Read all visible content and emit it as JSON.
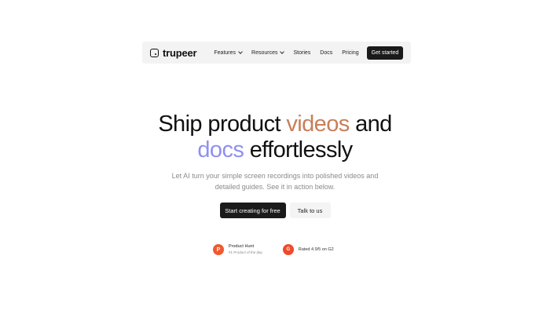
{
  "nav": {
    "brand": "trupeer",
    "links": [
      "Features",
      "Resources",
      "Stories",
      "Docs",
      "Pricing"
    ],
    "cta": "Get started"
  },
  "hero": {
    "line1_a": "Ship product ",
    "line1_b": "videos",
    "line1_c": " and",
    "line2_a": "docs",
    "line2_b": " effortlessly",
    "subtitle_1": "Let AI turn your simple screen recordings into polished videos and",
    "subtitle_2": "detailed guides. See it in action below.",
    "primary_cta": "Start creating for free",
    "secondary_cta": "Talk to us"
  },
  "badges": {
    "product_hunt": {
      "icon_letter": "P",
      "title": "Product Hunt",
      "subtitle": "#1 Product of the day"
    },
    "g2": {
      "icon_letter": "G",
      "text": "Rated 4.9/5 on G2"
    }
  },
  "colors": {
    "accent_orange": "#c97f59",
    "accent_violet": "#8f8ff0",
    "button_dark": "#1b1b1b",
    "badge_orange": "#f0592e"
  }
}
